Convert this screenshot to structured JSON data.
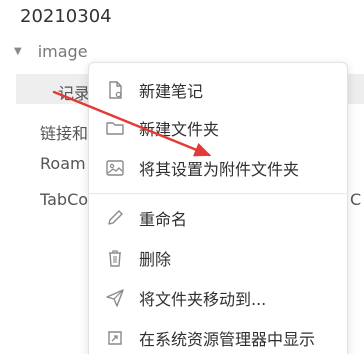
{
  "tree": {
    "root_title": "20210304",
    "folder_name": "image",
    "items": [
      "记录",
      "链接和",
      "Roam",
      "TabCo"
    ],
    "right_edge_char": "C"
  },
  "context_menu": {
    "items": [
      {
        "label": "新建笔记",
        "icon": "new-note-icon"
      },
      {
        "label": "新建文件夹",
        "icon": "folder-icon"
      },
      {
        "label": "将其设置为附件文件夹",
        "icon": "image-icon"
      },
      {
        "label": "重命名",
        "icon": "pencil-icon"
      },
      {
        "label": "删除",
        "icon": "trash-icon"
      },
      {
        "label": "将文件夹移动到...",
        "icon": "send-icon"
      },
      {
        "label": "在系统资源管理器中显示",
        "icon": "open-external-icon"
      }
    ]
  },
  "colors": {
    "annotation_arrow": "#e53935",
    "selected_row_bg": "#eeeeee"
  }
}
